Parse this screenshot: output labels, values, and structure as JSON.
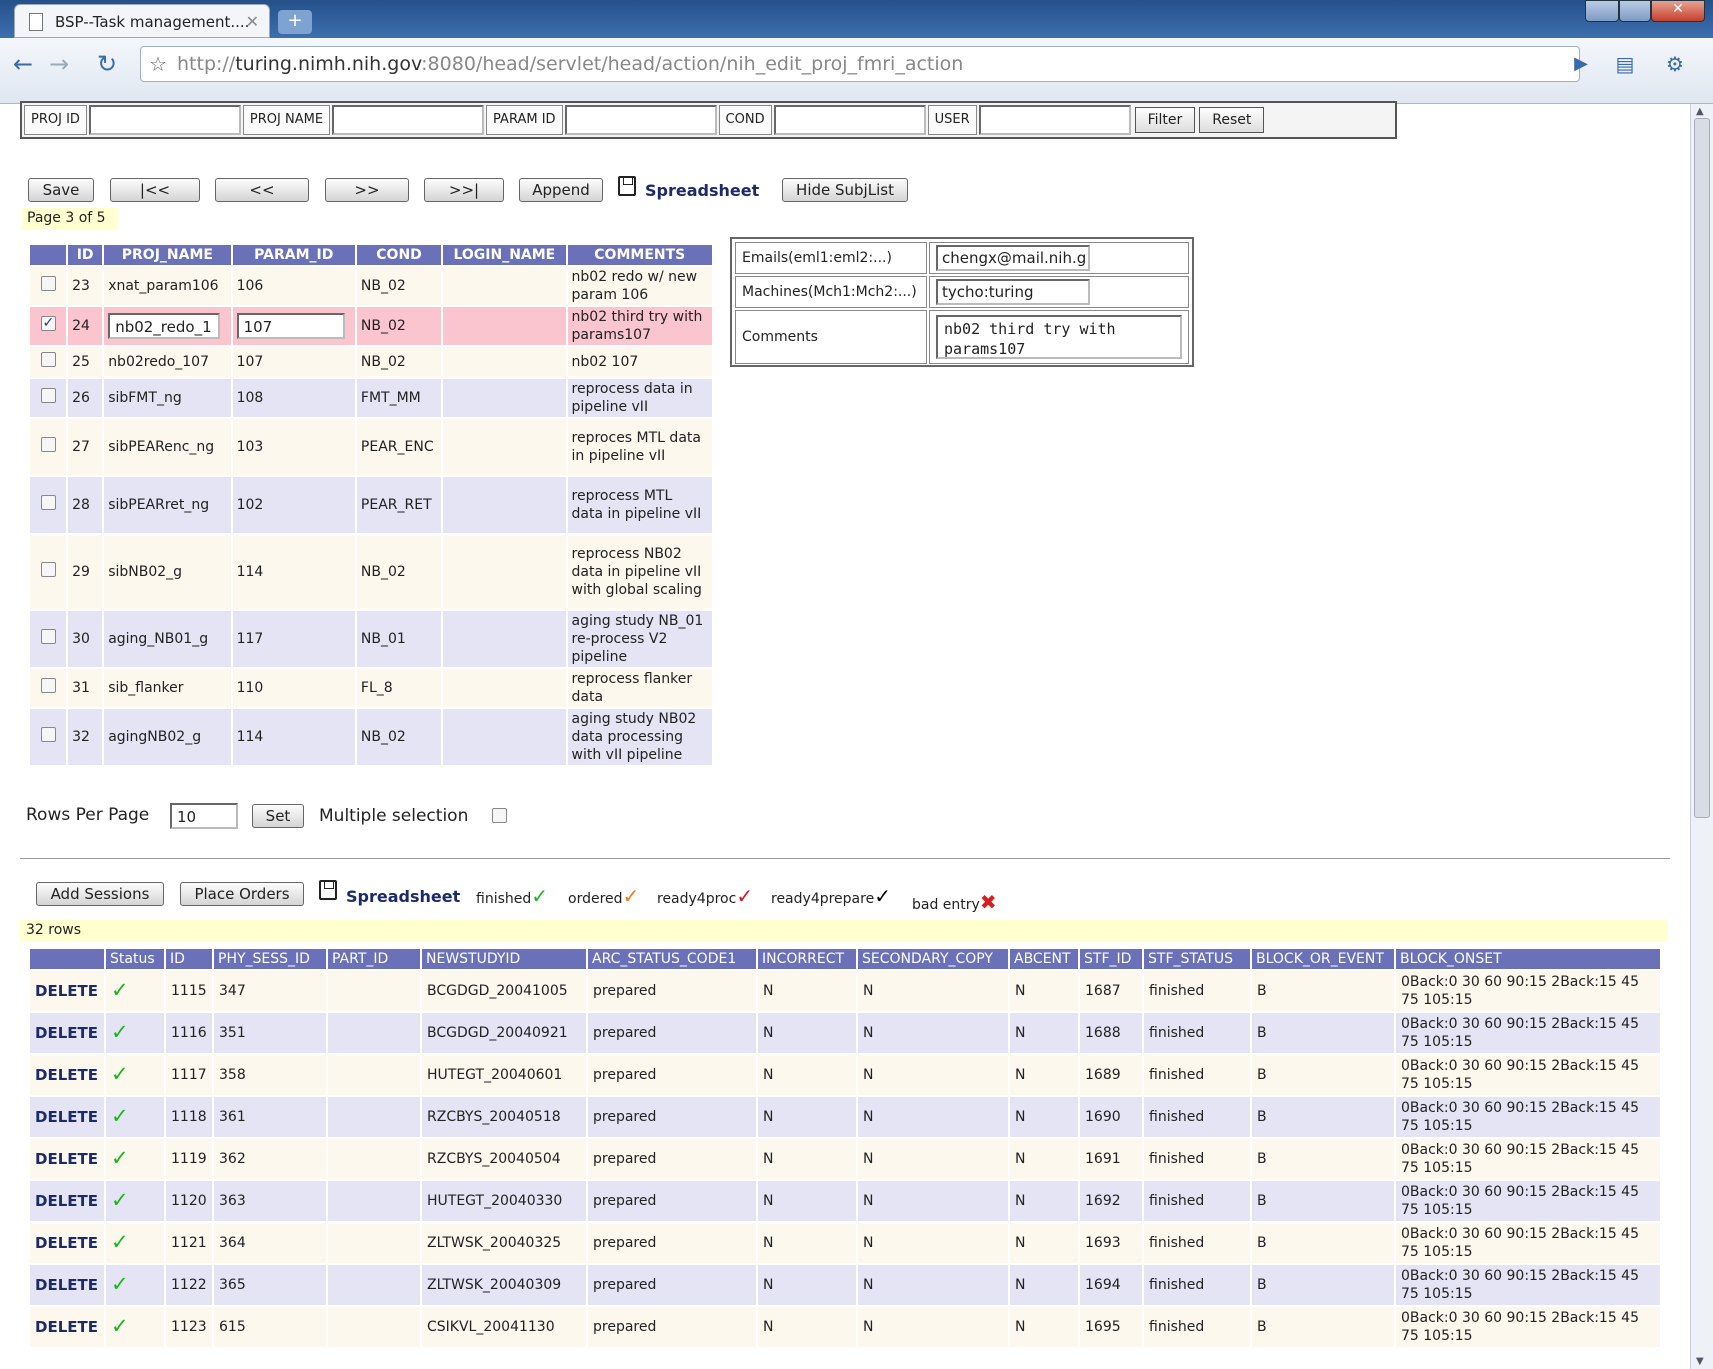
{
  "browser": {
    "tab_title": "BSP--Task management....",
    "url_prefix": "http://",
    "url_host": "turing.nimh.nih.gov",
    "url_path": ":8080/head/servlet/head/action/nih_edit_proj_fmri_action"
  },
  "filter": {
    "labels": [
      "PROJ ID",
      "PROJ NAME",
      "PARAM ID",
      "COND",
      "USER"
    ],
    "filter_label": "Filter",
    "reset_label": "Reset"
  },
  "toolbar": {
    "save": "Save",
    "first": "|<<",
    "prev": "<<",
    "next": ">>",
    "last": ">>|",
    "append": "Append",
    "spreadsheet": "Spreadsheet",
    "hide_subjlist": "Hide SubjList"
  },
  "page_info": "Page 3 of 5",
  "proj_table": {
    "headers": [
      "ID",
      "PROJ_NAME",
      "PARAM_ID",
      "COND",
      "LOGIN_NAME",
      "COMMENTS"
    ],
    "rows": [
      {
        "id": "23",
        "name": "xnat_param106",
        "param": "106",
        "cond": "NB_02",
        "login": "",
        "comments": "nb02 redo w/ new param 106"
      },
      {
        "id": "24",
        "name": "nb02_redo_1",
        "param": "107",
        "cond": "NB_02",
        "login": "",
        "comments": "nb02 third try with params107"
      },
      {
        "id": "25",
        "name": "nb02redo_107",
        "param": "107",
        "cond": "NB_02",
        "login": "",
        "comments": "nb02 107"
      },
      {
        "id": "26",
        "name": "sibFMT_ng",
        "param": "108",
        "cond": "FMT_MM",
        "login": "",
        "comments": "reprocess data in pipeline vII"
      },
      {
        "id": "27",
        "name": "sibPEARenc_ng",
        "param": "103",
        "cond": "PEAR_ENC",
        "login": "",
        "comments": "reproces MTL data in pipeline vII"
      },
      {
        "id": "28",
        "name": "sibPEARret_ng",
        "param": "102",
        "cond": "PEAR_RET",
        "login": "",
        "comments": "reprocess MTL data in pipeline vII"
      },
      {
        "id": "29",
        "name": "sibNB02_g",
        "param": "114",
        "cond": "NB_02",
        "login": "",
        "comments": "reprocess NB02 data in pipeline vII with global scaling"
      },
      {
        "id": "30",
        "name": "aging_NB01_g",
        "param": "117",
        "cond": "NB_01",
        "login": "",
        "comments": "aging study NB_01 re-process V2 pipeline"
      },
      {
        "id": "31",
        "name": "sib_flanker",
        "param": "110",
        "cond": "FL_8",
        "login": "",
        "comments": "reprocess flanker data"
      },
      {
        "id": "32",
        "name": "agingNB02_g",
        "param": "114",
        "cond": "NB_02",
        "login": "",
        "comments": "aging study NB02 data processing with vII pipeline"
      }
    ]
  },
  "detail": {
    "emails_label": "Emails(eml1:eml2:...)",
    "emails_value": "chengx@mail.nih.g",
    "machines_label": "Machines(Mch1:Mch2:...)",
    "machines_value": "tycho:turing",
    "comments_label": "Comments",
    "comments_value": "nb02 third try with params107"
  },
  "rows_per_page": {
    "label": "Rows Per Page",
    "value": "10",
    "set_label": "Set",
    "multi_label": "Multiple selection"
  },
  "sessions_toolbar": {
    "add_sessions": "Add Sessions",
    "place_orders": "Place Orders",
    "spreadsheet": "Spreadsheet",
    "legend": {
      "finished": "finished",
      "ordered": "ordered",
      "ready4proc": "ready4proc",
      "ready4prepare": "ready4prepare",
      "bad_entry": "bad entry"
    },
    "colors": {
      "finished": "#1db31d",
      "ordered": "#f07c10",
      "ready4proc": "#e0101e",
      "ready4prepare": "#000000",
      "bad_entry": "#d42020"
    }
  },
  "row_count": "32 rows",
  "sessions_table": {
    "headers": [
      "",
      "Status",
      "ID",
      "PHY_SESS_ID",
      "PART_ID",
      "NEWSTUDYID",
      "ARC_STATUS_CODE1",
      "INCORRECT",
      "SECONDARY_COPY",
      "ABCENT",
      "STF_ID",
      "STF_STATUS",
      "BLOCK_OR_EVENT",
      "BLOCK_ONSET"
    ],
    "rows": [
      {
        "action": "DELETE",
        "id": "1115",
        "phy": "347",
        "part": "",
        "study": "BCGDGD_20041005",
        "arc": "prepared",
        "inc": "N",
        "sec": "N",
        "abc": "N",
        "stf": "1687",
        "stfst": "finished",
        "boe": "B",
        "onset": "0Back:0 30 60 90:15 2Back:15 45 75 105:15"
      },
      {
        "action": "DELETE",
        "id": "1116",
        "phy": "351",
        "part": "",
        "study": "BCGDGD_20040921",
        "arc": "prepared",
        "inc": "N",
        "sec": "N",
        "abc": "N",
        "stf": "1688",
        "stfst": "finished",
        "boe": "B",
        "onset": "0Back:0 30 60 90:15 2Back:15 45 75 105:15"
      },
      {
        "action": "DELETE",
        "id": "1117",
        "phy": "358",
        "part": "",
        "study": "HUTEGT_20040601",
        "arc": "prepared",
        "inc": "N",
        "sec": "N",
        "abc": "N",
        "stf": "1689",
        "stfst": "finished",
        "boe": "B",
        "onset": "0Back:0 30 60 90:15 2Back:15 45 75 105:15"
      },
      {
        "action": "DELETE",
        "id": "1118",
        "phy": "361",
        "part": "",
        "study": "RZCBYS_20040518",
        "arc": "prepared",
        "inc": "N",
        "sec": "N",
        "abc": "N",
        "stf": "1690",
        "stfst": "finished",
        "boe": "B",
        "onset": "0Back:0 30 60 90:15 2Back:15 45 75 105:15"
      },
      {
        "action": "DELETE",
        "id": "1119",
        "phy": "362",
        "part": "",
        "study": "RZCBYS_20040504",
        "arc": "prepared",
        "inc": "N",
        "sec": "N",
        "abc": "N",
        "stf": "1691",
        "stfst": "finished",
        "boe": "B",
        "onset": "0Back:0 30 60 90:15 2Back:15 45 75 105:15"
      },
      {
        "action": "DELETE",
        "id": "1120",
        "phy": "363",
        "part": "",
        "study": "HUTEGT_20040330",
        "arc": "prepared",
        "inc": "N",
        "sec": "N",
        "abc": "N",
        "stf": "1692",
        "stfst": "finished",
        "boe": "B",
        "onset": "0Back:0 30 60 90:15 2Back:15 45 75 105:15"
      },
      {
        "action": "DELETE",
        "id": "1121",
        "phy": "364",
        "part": "",
        "study": "ZLTWSK_20040325",
        "arc": "prepared",
        "inc": "N",
        "sec": "N",
        "abc": "N",
        "stf": "1693",
        "stfst": "finished",
        "boe": "B",
        "onset": "0Back:0 30 60 90:15 2Back:15 45 75 105:15"
      },
      {
        "action": "DELETE",
        "id": "1122",
        "phy": "365",
        "part": "",
        "study": "ZLTWSK_20040309",
        "arc": "prepared",
        "inc": "N",
        "sec": "N",
        "abc": "N",
        "stf": "1694",
        "stfst": "finished",
        "boe": "B",
        "onset": "0Back:0 30 60 90:15 2Back:15 45 75 105:15"
      },
      {
        "action": "DELETE",
        "id": "1123",
        "phy": "615",
        "part": "",
        "study": "CSIKVL_20041130",
        "arc": "prepared",
        "inc": "N",
        "sec": "N",
        "abc": "N",
        "stf": "1695",
        "stfst": "finished",
        "boe": "B",
        "onset": "0Back:0 30 60 90:15 2Back:15 45 75 105:15"
      }
    ]
  }
}
